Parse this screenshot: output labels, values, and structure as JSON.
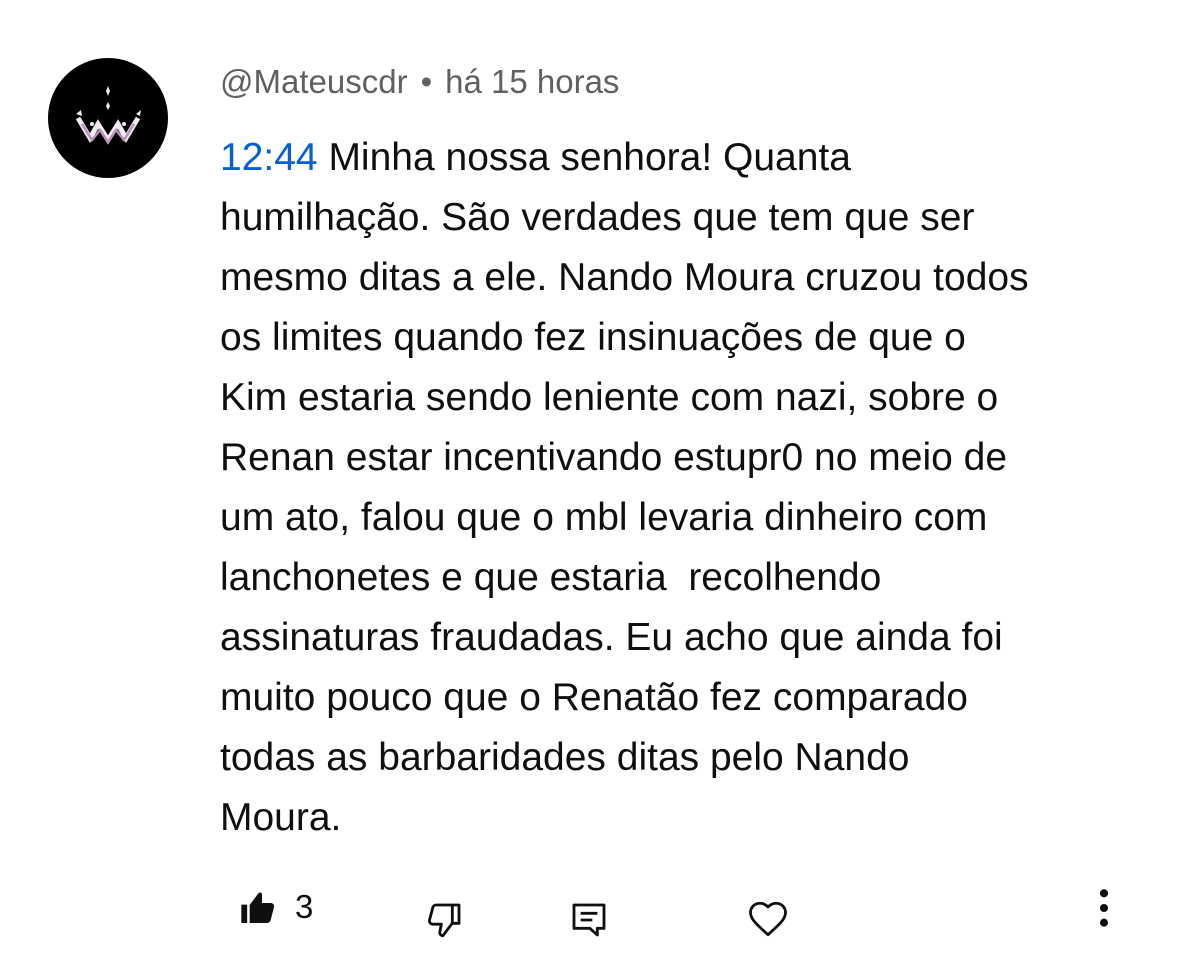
{
  "comment": {
    "author": "@Mateuscdr",
    "separator": "•",
    "time_ago": "há 15 horas",
    "timestamp_link": "12:44",
    "lines": [
      " Minha nossa senhora! Quanta",
      "humilhação. São verdades que tem que ser",
      "mesmo ditas a ele. Nando Moura cruzou todos",
      "os limites quando fez insinuações de que o",
      "Kim estaria sendo leniente com nazi, sobre o",
      "Renan estar incentivando estupr0 no meio de",
      "um ato, falou que o mbl levaria dinheiro com",
      "lanchonetes e que estaria  recolhendo",
      "assinaturas fraudadas. Eu acho que ainda foi",
      "muito pouco que o Renatão fez comparado",
      "todas as barbaridades ditas pelo Nando",
      "Moura."
    ]
  },
  "actions": {
    "like_count": "3",
    "like_icon": "thumbs-up-filled-icon",
    "dislike_icon": "thumbs-down-outline-icon",
    "reply_icon": "comment-reply-icon",
    "heart_icon": "heart-outline-icon",
    "more_icon": "more-vertical-icon"
  },
  "colors": {
    "link": "#065fd4",
    "meta_text": "#606060",
    "body_text": "#0f0f0f",
    "avatar_bg": "#000000"
  }
}
